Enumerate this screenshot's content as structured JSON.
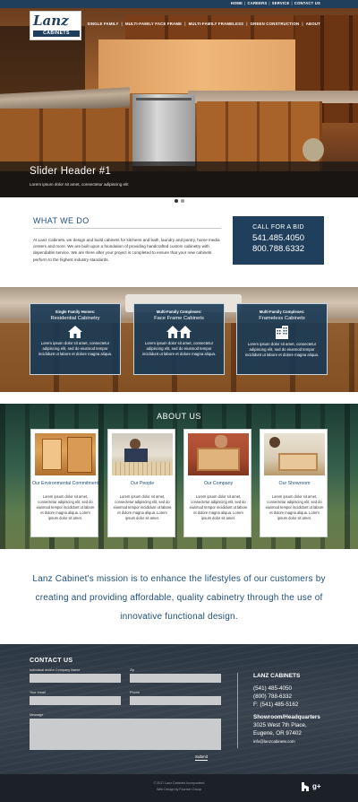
{
  "topbar": {
    "links": [
      "HOME",
      "CAREERS",
      "SERVICE",
      "CONTACT US"
    ]
  },
  "brand": {
    "logo_word": "Lanz",
    "logo_sub": "CABINETS"
  },
  "nav": {
    "items": [
      "SINGLE FAMILY",
      "MULTI-FAMILY FACE FRAME",
      "MULTI-FAMILY FRAMELESS",
      "GREEN CONSTRUCTION",
      "ABOUT"
    ]
  },
  "slider": {
    "title": "Slider Header #1",
    "subtitle": "Lorem ipsum dolor sit amet, consectetur adipiscing elit"
  },
  "what_we_do": {
    "title": "WHAT WE DO",
    "body": "At Lanz Cabinets, we design and build cabinets for kitchens and bath, laundry and pantry, home media centers and more. We are built upon a foundation of providing handcrafted custom cabinetry with dependable service. We are there after your project is completed to ensure that your new cabinets perform to the highest industry standards."
  },
  "call_box": {
    "title": "CALL FOR A BID",
    "phone1": "541.485.4050",
    "phone2": "800.788.6332"
  },
  "services": [
    {
      "kicker": "Single Family Homes:",
      "name": "Residential Cabinetry",
      "icon": "house-icon",
      "text": "Lorem ipsum dolor sit amet, consectetur adipiscing elit, sed do eiusmod tempor incididunt ut labore et dolore magna aliqua."
    },
    {
      "kicker": "Multi-Family Complexes:",
      "name": "Face Frame Cabinets",
      "icon": "townhouse-icon",
      "text": "Lorem ipsum dolor sit amet, consectetur adipiscing elit, sed do eiusmod tempor incididunt ut labore et dolore magna aliqua."
    },
    {
      "kicker": "Multi-Family Complexes:",
      "name": "Frameless Cabinets",
      "icon": "building-icon",
      "text": "Lorem ipsum dolor sit amet, consectetur adipiscing elit, sed do eiusmod tempor incididunt ut labore et dolore magna aliqua."
    }
  ],
  "about": {
    "title": "ABOUT US",
    "cards": [
      {
        "label": "Our Environmental Commitment",
        "text": "Lorem ipsum dolor sit amet, consectetur adipiscing elit, sed do eiusmod tempor incididunt ut labore et dolore magna aliqua. Lorem ipsum dolor sit amet."
      },
      {
        "label": "Our People",
        "text": "Lorem ipsum dolor sit amet, consectetur adipiscing elit, sed do eiusmod tempor incididunt ut labore et dolore magna aliqua. Lorem ipsum dolor sit amet."
      },
      {
        "label": "Our Company",
        "text": "Lorem ipsum dolor sit amet, consectetur adipiscing elit, sed do eiusmod tempor incididunt ut labore et dolore magna aliqua. Lorem ipsum dolor sit amet."
      },
      {
        "label": "Our Showroom",
        "text": "Lorem ipsum dolor sit amet, consectetur adipiscing elit, sed do eiusmod tempor incididunt ut labore et dolore magna aliqua. Lorem ipsum dolor sit amet."
      }
    ]
  },
  "mission": {
    "text": "Lanz Cabinet's mission is to enhance the lifestyles of our customers by creating and providing affordable, quality cabinetry through the use of innovative functional design."
  },
  "contact": {
    "title": "CONTACT US",
    "fields": {
      "name_label": "Individual and/or Company Name",
      "zip_label": "Zip",
      "email_label": "Your email",
      "phone_label": "Phone",
      "message_label": "Message"
    },
    "submit": "Submit",
    "company": "LANZ CABINETS",
    "phone1": "(541) 485-4050",
    "phone2": "(800) 788-6332",
    "fax": "F: (541) 485-5162",
    "showroom_label": "Showroom/Headquarters",
    "address1": "3025 West 7th Place,",
    "address2": "Eugene, OR 97402",
    "email": "info@lanzcabinets.com"
  },
  "footer": {
    "copyright": "© 2017 Lanz Cabinets Incorporated",
    "credit": "Web Design by Fourmer Group",
    "social": [
      "houzz-icon",
      "google-plus-icon"
    ]
  },
  "colors": {
    "navy": "#1f3f5d",
    "heading_blue": "#1f4f78",
    "contact_bg": "#38434f",
    "footer_bg": "#1c2128"
  }
}
